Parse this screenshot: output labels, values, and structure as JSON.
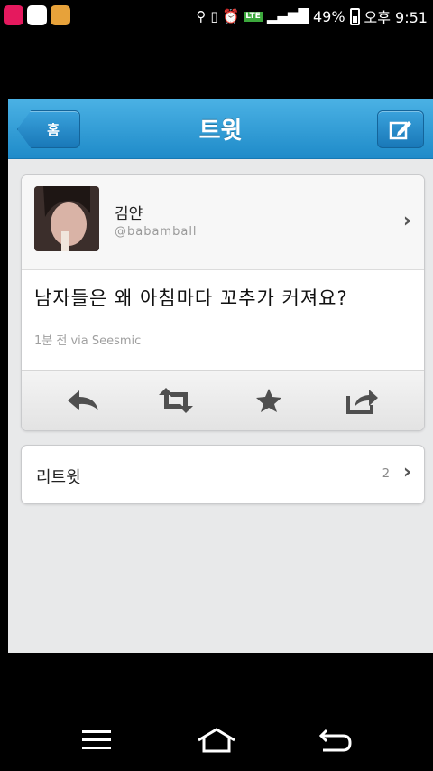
{
  "status_bar": {
    "battery": "49%",
    "time": "오후 9:51",
    "network": "LTE"
  },
  "header": {
    "back_label": "홈",
    "title": "트윗"
  },
  "tweet": {
    "user_name": "김얀",
    "user_handle": "@babamball",
    "text": "남자들은 왜 아침마다 꼬추가 커져요?",
    "meta": "1분 전 via Seesmic"
  },
  "retweets": {
    "label": "리트윗",
    "count": "2"
  },
  "colors": {
    "header_blue": "#1f8bc9",
    "background": "#e8e9ea"
  }
}
